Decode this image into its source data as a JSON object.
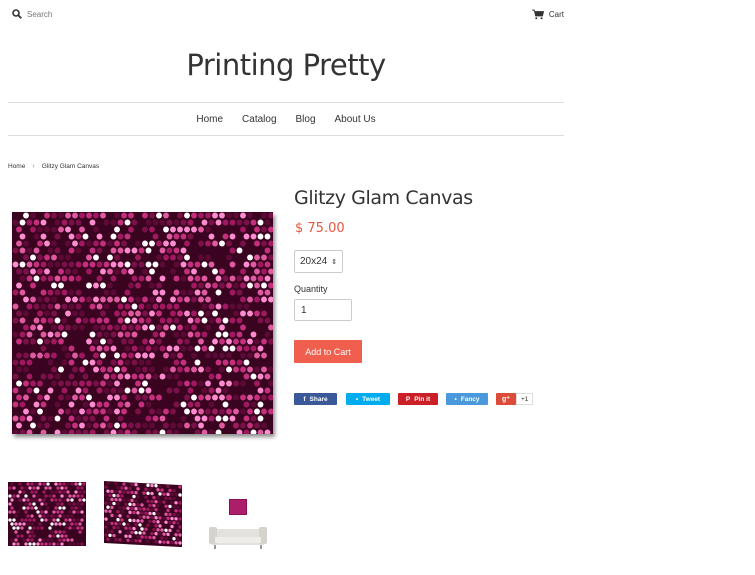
{
  "header": {
    "search_placeholder": "Search",
    "cart_label": "Cart",
    "icons": [
      "search-icon",
      "cart-icon"
    ]
  },
  "brand": {
    "name": "Printing Pretty"
  },
  "nav": {
    "items": [
      {
        "label": "Home"
      },
      {
        "label": "Catalog"
      },
      {
        "label": "Blog"
      },
      {
        "label": "About Us"
      }
    ]
  },
  "breadcrumb": {
    "home": "Home",
    "separator": "›",
    "current": "Glitzy Glam Canvas"
  },
  "product": {
    "title": "Glitzy Glam Canvas",
    "price": "$ 75.00",
    "variant_selected": "20x24",
    "variant_caret": "⇕",
    "quantity_label": "Quantity",
    "quantity_value": "1",
    "add_to_cart": "Add to Cart"
  },
  "share": {
    "facebook": {
      "icon": "f",
      "label": "Share"
    },
    "twitter": {
      "icon": "•",
      "label": "Tweet"
    },
    "pinterest": {
      "icon": "P",
      "label": "Pin it"
    },
    "fancy": {
      "icon": "•",
      "label": "Fancy"
    },
    "gplus": {
      "icon": "g⁺",
      "count": "+1"
    }
  },
  "colors": {
    "accent": "#f05e4d",
    "price": "#e8573f",
    "facebook": "#3b5998",
    "twitter": "#00aced",
    "pinterest": "#cb2027",
    "fancy": "#4999dc",
    "gplus": "#dd4b39",
    "sequin_base": "#3a0420",
    "sequin_mid": "#a01860",
    "sequin_hi": "#ff8cd0"
  }
}
